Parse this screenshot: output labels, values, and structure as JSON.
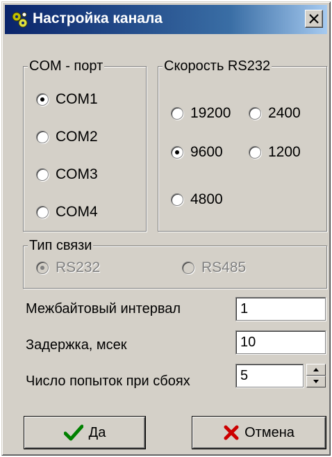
{
  "window": {
    "title": "Настройка канала"
  },
  "com_group": {
    "legend": "COM - порт",
    "options": [
      "COM1",
      "COM2",
      "COM3",
      "COM4"
    ],
    "selected": "COM1"
  },
  "speed_group": {
    "legend": "Скорость RS232",
    "options": [
      "19200",
      "2400",
      "9600",
      "1200",
      "4800"
    ],
    "selected": "9600"
  },
  "link_group": {
    "legend": "Тип связи",
    "options": [
      "RS232",
      "RS485"
    ],
    "selected": "RS232",
    "enabled": false
  },
  "fields": {
    "interbyte_label": "Межбайтовый интервал",
    "interbyte_value": "1",
    "delay_label": "Задержка, мсек",
    "delay_value": "10",
    "retries_label": "Число попыток при сбоях",
    "retries_value": "5"
  },
  "buttons": {
    "ok": "Да",
    "cancel": "Отмена"
  },
  "colors": {
    "check": "#008000",
    "cross": "#cc0000",
    "title_bar": "#0a246a"
  },
  "icons": {
    "app": "gears-icon",
    "ok": "checkmark-icon",
    "cancel": "cross-icon"
  }
}
